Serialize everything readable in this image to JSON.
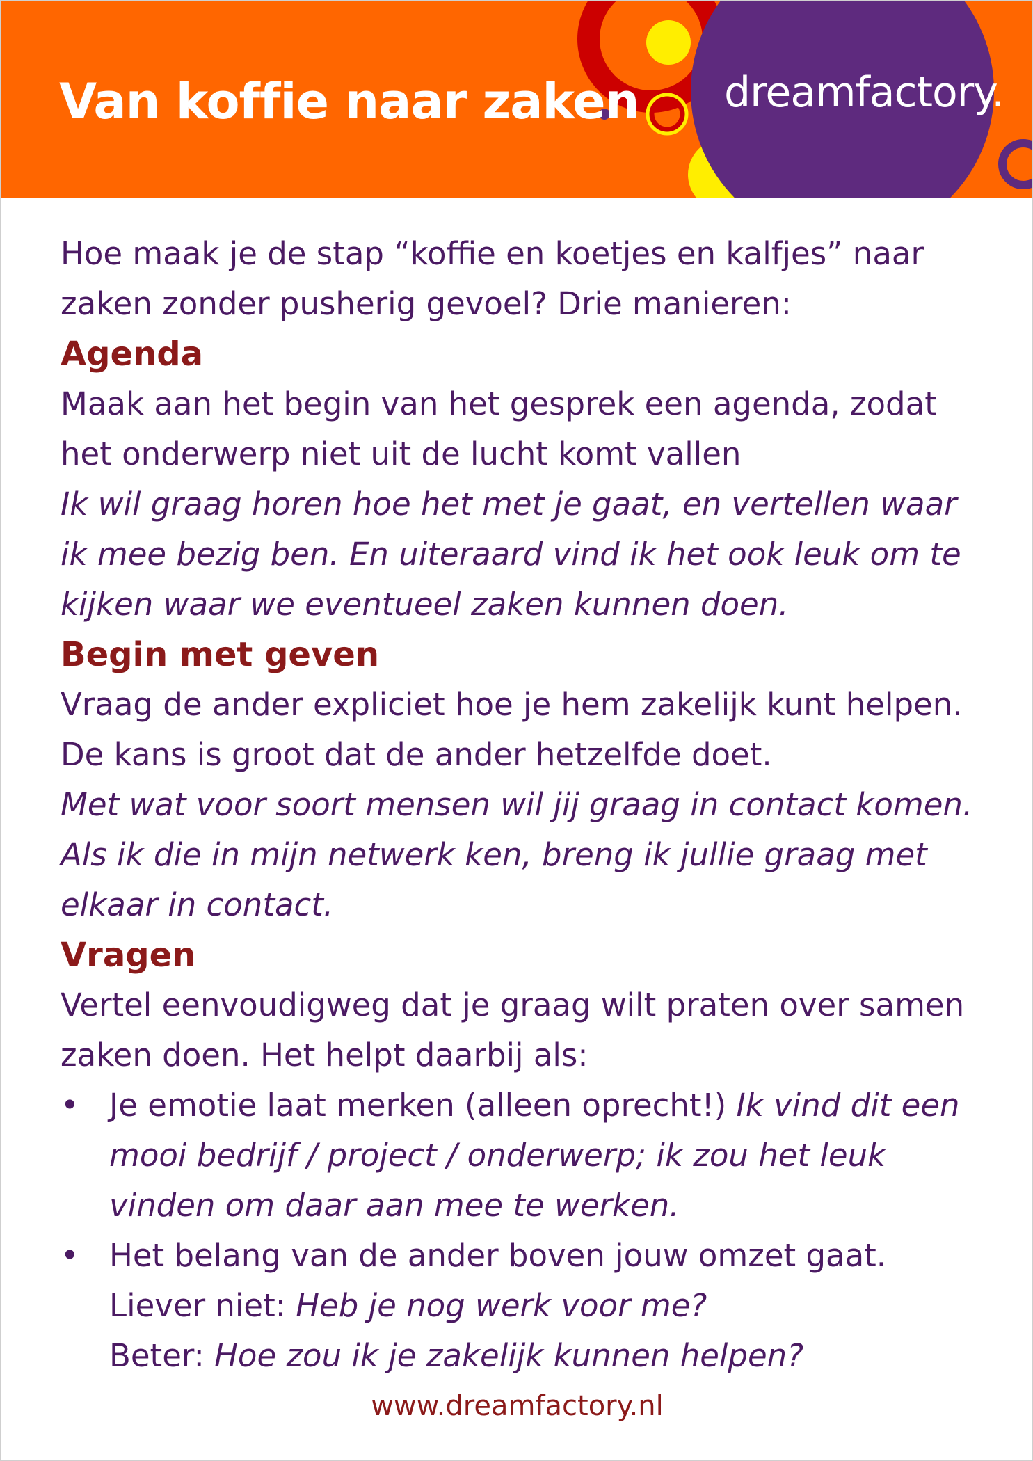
{
  "header": {
    "title": "Van koffie naar zaken",
    "logo": "dreamfactory."
  },
  "intro": "Hoe maak je de stap “koffie en koetjes en kalfjes” naar zaken zonder pusherig gevoel? Drie manieren:",
  "sections": [
    {
      "heading": "Agenda",
      "body": "Maak aan het begin van het gesprek een agenda, zodat het onderwerp niet uit de lucht komt vallen",
      "example": "Ik wil graag horen hoe het met je gaat, en vertellen waar ik mee bezig ben. En uiteraard vind ik het ook leuk om te kijken waar we eventueel zaken kunnen doen."
    },
    {
      "heading": "Begin met geven",
      "body": "Vraag de ander expliciet hoe je hem zakelijk kunt helpen. De kans is groot dat de ander hetzelfde doet.",
      "example": "Met wat voor soort mensen wil jij graag in contact komen. Als ik die in mijn netwerk ken, breng ik jullie graag met elkaar in contact."
    },
    {
      "heading": "Vragen",
      "body": "Vertel eenvoudigweg dat je graag wilt praten over samen zaken doen. Het helpt daarbij als:",
      "bullets": [
        {
          "text": "Je emotie laat merken (alleen oprecht!)",
          "example": "Ik vind dit een mooi bedrijf / project / onderwerp; ik zou het leuk vinden om daar aan mee te werken."
        },
        {
          "text": "Het belang van de ander boven jouw omzet gaat.",
          "not_label": "Liever niet:",
          "not_example": "Heb je nog werk voor me?",
          "better_label": "Beter:",
          "better_example": "Hoe zou ik je zakelijk kunnen helpen?"
        }
      ]
    }
  ],
  "footer": {
    "url": "www.dreamfactory.nl"
  },
  "colors": {
    "header_bg": "#ff6600",
    "logo_circle": "#5e2a7e",
    "accent_yellow": "#ffee00",
    "accent_red": "#cc0000",
    "heading": "#8b1a1a",
    "body_text": "#4b1a63"
  },
  "bullet_glyph": "•"
}
